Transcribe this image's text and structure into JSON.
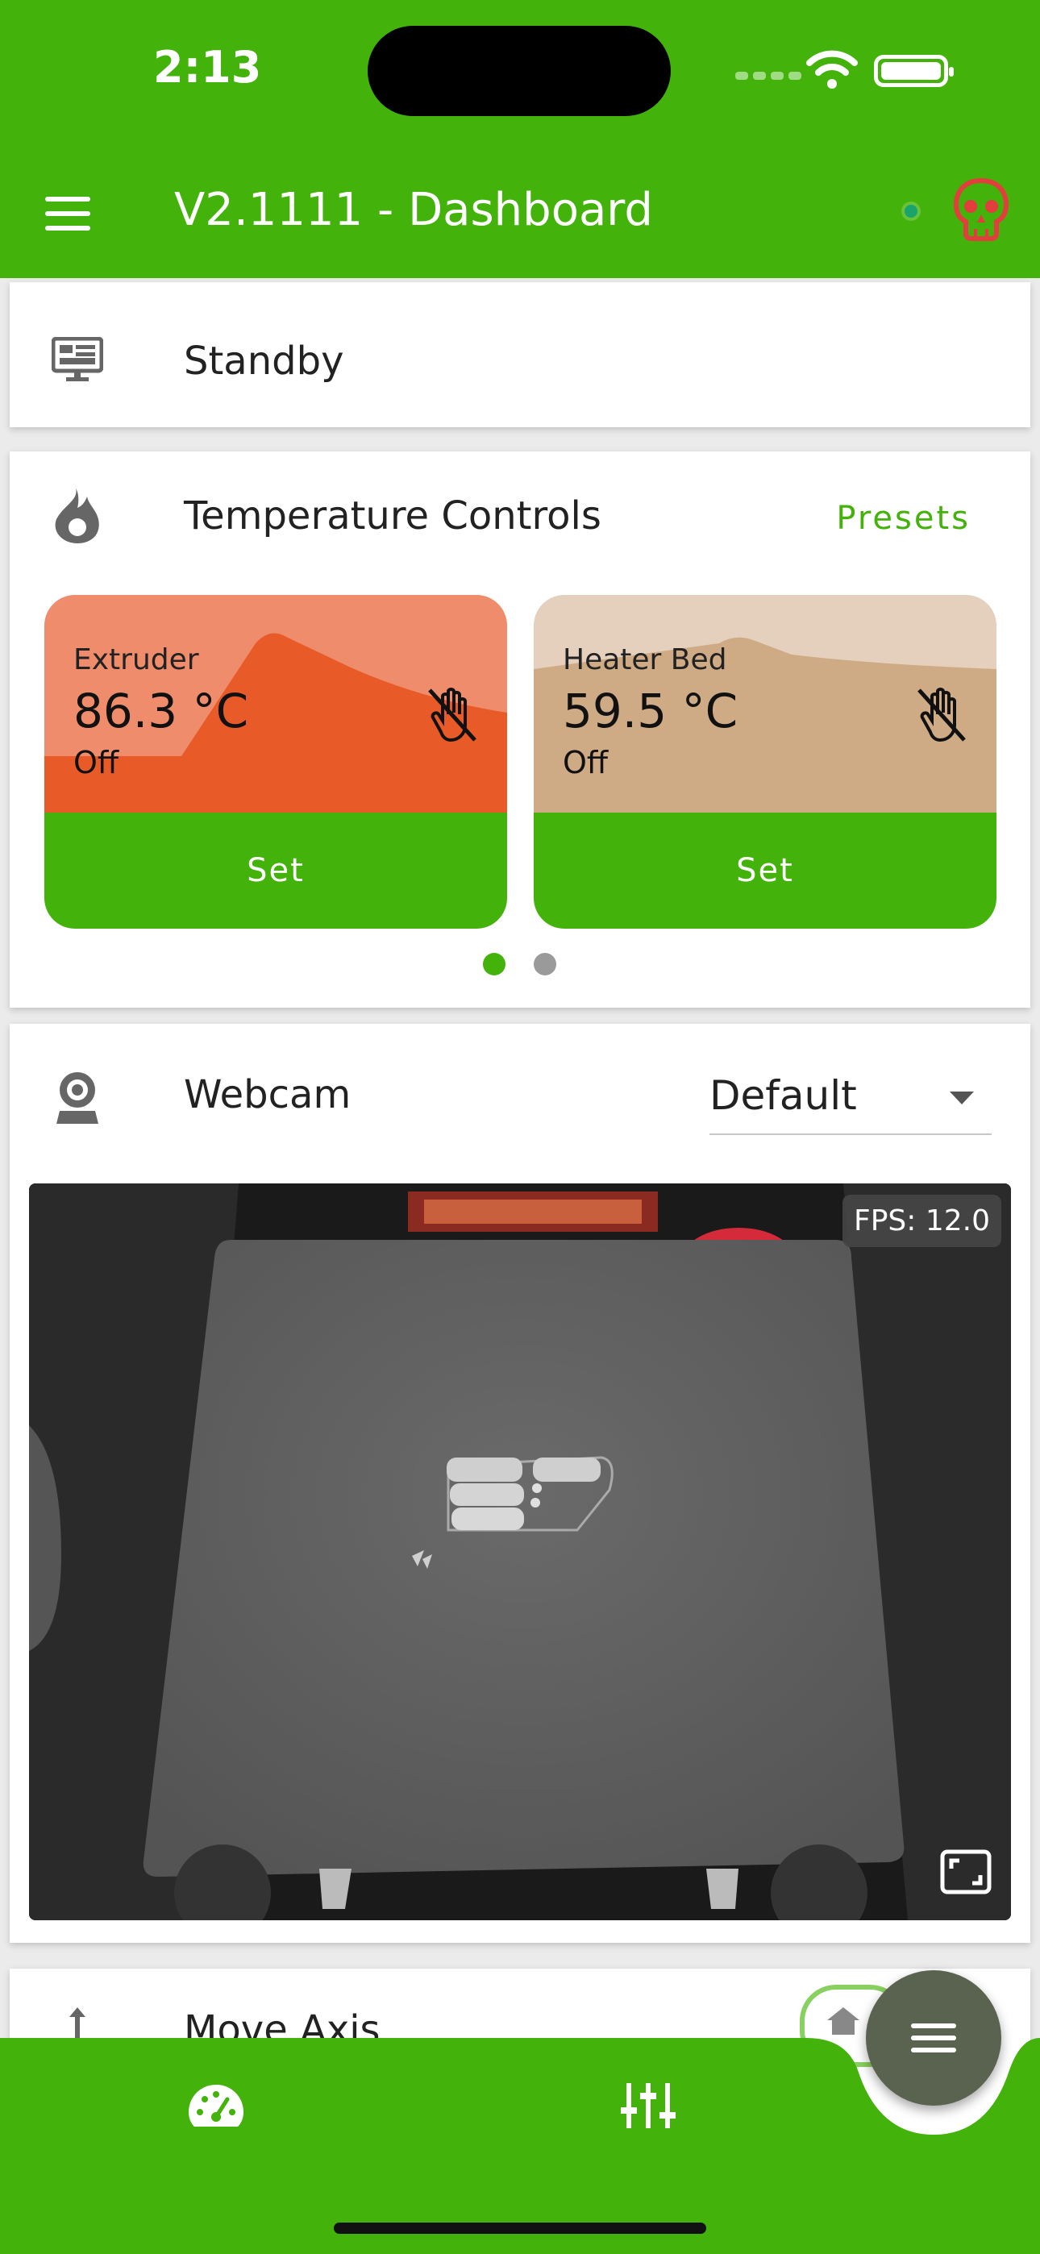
{
  "status_bar": {
    "time": "2:13"
  },
  "app_bar": {
    "title": "V2.1111 - Dashboard"
  },
  "standby_card": {
    "title": "Standby"
  },
  "temperature_card": {
    "title": "Temperature Controls",
    "presets_label": "Presets",
    "tiles": [
      {
        "name": "Extruder",
        "temperature": "86.3 °C",
        "state": "Off",
        "set_label": "Set"
      },
      {
        "name": "Heater Bed",
        "temperature": "59.5 °C",
        "state": "Off",
        "set_label": "Set"
      }
    ],
    "page_indicator": {
      "current": 1,
      "total": 2
    }
  },
  "webcam_card": {
    "title": "Webcam",
    "selected_camera": "Default",
    "fps_label": "FPS: 12.0"
  },
  "move_axis_card": {
    "title": "Move Axis"
  },
  "colors": {
    "accent": "#43b20a",
    "extruder_graph": "#e85a27",
    "extruder_bg": "#ee8c6c",
    "bed_graph": "#ceaa85",
    "bed_bg": "#e4d0bd",
    "alert": "#e33d3d"
  }
}
